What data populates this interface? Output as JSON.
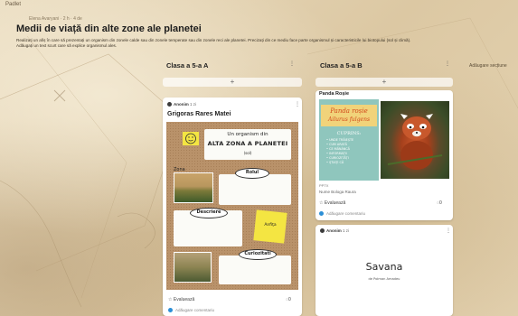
{
  "app": {
    "name": "Padlet"
  },
  "board": {
    "meta": "Elena Avaryani · 2 h · 4 de",
    "title": "Medii de viață din alte zone ale planetei",
    "description_line1": "Realizați un afiș în care să prezentați un organism din zonele calde sau din zonele temperate sau din zonele reci ale planetei. Precizați din ce mediu face parte organismul și caracteristicile lui biotopului (sol și climă).",
    "description_line2": "Adăugați un text scurt care să explice organismul ales."
  },
  "add_section_label": "Adăugare secțiune",
  "columns": [
    {
      "title": "Clasa a 5-a A",
      "more": "⋮",
      "add": "+"
    },
    {
      "title": "Clasa a 5-a B",
      "more": "⋮",
      "add": "+"
    }
  ],
  "post_a": {
    "author": "Anonim",
    "time": "1 zi",
    "title": "Grigoras Rares Matei",
    "poster": {
      "heading_small": "Un organism din",
      "heading_big": "ALTA ZONA A PLANETEI",
      "heading_sub": "(sol)",
      "label_zona": "Zona",
      "label_rolul": "Rolul",
      "label_descriere": "Descriere",
      "label_curiozitati": "Curiozitati",
      "sticky_text": "Anfiţa"
    },
    "reaction_label": "Evaluează",
    "comment_count": "0",
    "comment_placeholder": "Adăugare comentariu"
  },
  "post_b1": {
    "title": "Panda Roșie",
    "banner_top": "Panda roșie",
    "banner_sub": "Ailurus fulgens",
    "list_heading": "CUPRINS:",
    "list_items": [
      "• UNDE TRĂIEȘTE",
      "• CUM ARATĂ",
      "• CE MĂNÂNCĂ",
      "• INFORMAȚII",
      "• CURIOZITĂȚI",
      "• ȘTIAȚI CĂ"
    ],
    "author_line": "Nume Bologa Raura",
    "file_tag": "PPTX",
    "reaction_label": "Evaluează",
    "comment_count": "0",
    "comment_placeholder": "Adăugare comentariu"
  },
  "post_b2": {
    "author": "Anonim",
    "time": "1 zi",
    "slide_title": "Savana",
    "slide_sub": "de Polman Amadeu"
  },
  "colors": {
    "accent": "#2c8fd6",
    "poster_bg": "#b9926a",
    "banner_bg": "#8fc6bd",
    "banner_text": "#d24a1c"
  }
}
